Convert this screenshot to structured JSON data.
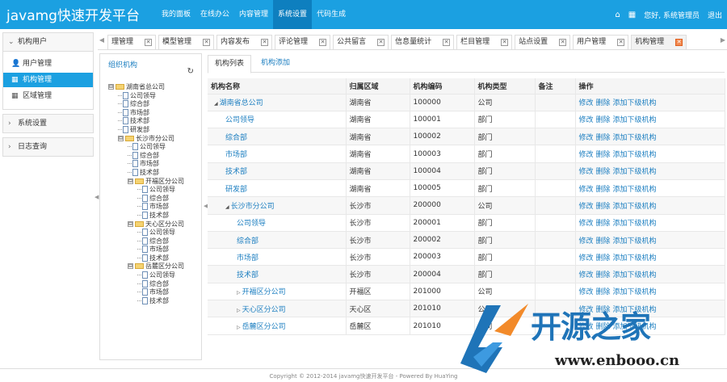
{
  "header": {
    "brand": "javamg快速开发平台",
    "nav": [
      {
        "label": "我的面板",
        "active": false
      },
      {
        "label": "在线办公",
        "active": false
      },
      {
        "label": "内容管理",
        "active": false
      },
      {
        "label": "系统设置",
        "active": true
      },
      {
        "label": "代码生成",
        "active": false
      }
    ],
    "user_text": "您好, 系统管理员",
    "logout": "退出"
  },
  "sidebar": {
    "groups": [
      {
        "label": "机构用户",
        "open": true,
        "items": [
          {
            "label": "用户管理",
            "icon": "user-icon",
            "glyph": "👤",
            "active": false
          },
          {
            "label": "机构管理",
            "icon": "grid-icon",
            "glyph": "▦",
            "active": true
          },
          {
            "label": "区域管理",
            "icon": "grid-small-icon",
            "glyph": "▦",
            "active": false
          }
        ]
      },
      {
        "label": "系统设置",
        "open": false,
        "items": []
      },
      {
        "label": "日志查询",
        "open": false,
        "items": []
      }
    ]
  },
  "tabs": [
    {
      "label": "理管理",
      "current": false
    },
    {
      "label": "模型管理",
      "current": false
    },
    {
      "label": "内容发布",
      "current": false
    },
    {
      "label": "评论管理",
      "current": false
    },
    {
      "label": "公共留言",
      "current": false
    },
    {
      "label": "信息量统计",
      "current": false
    },
    {
      "label": "栏目管理",
      "current": false
    },
    {
      "label": "站点设置",
      "current": false
    },
    {
      "label": "用户管理",
      "current": false
    },
    {
      "label": "机构管理",
      "current": true
    }
  ],
  "org_panel": {
    "title": "组织机构",
    "tree": [
      {
        "label": "湖南省总公司",
        "level": 0,
        "type": "folder",
        "toggle": "⊟"
      },
      {
        "label": "公司领导",
        "level": 1,
        "type": "doc"
      },
      {
        "label": "综合部",
        "level": 1,
        "type": "doc"
      },
      {
        "label": "市场部",
        "level": 1,
        "type": "doc"
      },
      {
        "label": "技术部",
        "level": 1,
        "type": "doc"
      },
      {
        "label": "研发部",
        "level": 1,
        "type": "doc"
      },
      {
        "label": "长沙市分公司",
        "level": 1,
        "type": "folder",
        "toggle": "⊟"
      },
      {
        "label": "公司领导",
        "level": 2,
        "type": "doc"
      },
      {
        "label": "综合部",
        "level": 2,
        "type": "doc"
      },
      {
        "label": "市场部",
        "level": 2,
        "type": "doc"
      },
      {
        "label": "技术部",
        "level": 2,
        "type": "doc"
      },
      {
        "label": "开福区分公司",
        "level": 2,
        "type": "folder",
        "toggle": "⊟"
      },
      {
        "label": "公司领导",
        "level": 3,
        "type": "doc"
      },
      {
        "label": "综合部",
        "level": 3,
        "type": "doc"
      },
      {
        "label": "市场部",
        "level": 3,
        "type": "doc"
      },
      {
        "label": "技术部",
        "level": 3,
        "type": "doc"
      },
      {
        "label": "天心区分公司",
        "level": 2,
        "type": "folder",
        "toggle": "⊟"
      },
      {
        "label": "公司领导",
        "level": 3,
        "type": "doc"
      },
      {
        "label": "综合部",
        "level": 3,
        "type": "doc"
      },
      {
        "label": "市场部",
        "level": 3,
        "type": "doc"
      },
      {
        "label": "技术部",
        "level": 3,
        "type": "doc"
      },
      {
        "label": "岳麓区分公司",
        "level": 2,
        "type": "folder",
        "toggle": "⊟"
      },
      {
        "label": "公司领导",
        "level": 3,
        "type": "doc"
      },
      {
        "label": "综合部",
        "level": 3,
        "type": "doc"
      },
      {
        "label": "市场部",
        "level": 3,
        "type": "doc"
      },
      {
        "label": "技术部",
        "level": 3,
        "type": "doc"
      }
    ]
  },
  "subtabs": {
    "list": "机构列表",
    "add": "机构添加"
  },
  "table": {
    "columns": [
      "机构名称",
      "归属区域",
      "机构编码",
      "机构类型",
      "备注",
      "操作"
    ],
    "ops": [
      "修改",
      "删除",
      "添加下级机构"
    ],
    "rows": [
      {
        "name": "湖南省总公司",
        "level": 0,
        "arrow": "◢",
        "region": "湖南省",
        "code": "100000",
        "type": "公司",
        "remark": ""
      },
      {
        "name": "公司领导",
        "level": 1,
        "arrow": "",
        "region": "湖南省",
        "code": "100001",
        "type": "部门",
        "remark": ""
      },
      {
        "name": "综合部",
        "level": 1,
        "arrow": "",
        "region": "湖南省",
        "code": "100002",
        "type": "部门",
        "remark": ""
      },
      {
        "name": "市场部",
        "level": 1,
        "arrow": "",
        "region": "湖南省",
        "code": "100003",
        "type": "部门",
        "remark": ""
      },
      {
        "name": "技术部",
        "level": 1,
        "arrow": "",
        "region": "湖南省",
        "code": "100004",
        "type": "部门",
        "remark": ""
      },
      {
        "name": "研发部",
        "level": 1,
        "arrow": "",
        "region": "湖南省",
        "code": "100005",
        "type": "部门",
        "remark": ""
      },
      {
        "name": "长沙市分公司",
        "level": 1,
        "arrow": "◢",
        "region": "长沙市",
        "code": "200000",
        "type": "公司",
        "remark": ""
      },
      {
        "name": "公司领导",
        "level": 2,
        "arrow": "",
        "region": "长沙市",
        "code": "200001",
        "type": "部门",
        "remark": ""
      },
      {
        "name": "综合部",
        "level": 2,
        "arrow": "",
        "region": "长沙市",
        "code": "200002",
        "type": "部门",
        "remark": ""
      },
      {
        "name": "市场部",
        "level": 2,
        "arrow": "",
        "region": "长沙市",
        "code": "200003",
        "type": "部门",
        "remark": ""
      },
      {
        "name": "技术部",
        "level": 2,
        "arrow": "",
        "region": "长沙市",
        "code": "200004",
        "type": "部门",
        "remark": ""
      },
      {
        "name": "开福区分公司",
        "level": 2,
        "arrow": "▷",
        "region": "开福区",
        "code": "201000",
        "type": "公司",
        "remark": ""
      },
      {
        "name": "天心区分公司",
        "level": 2,
        "arrow": "▷",
        "region": "天心区",
        "code": "201010",
        "type": "公司",
        "remark": ""
      },
      {
        "name": "岳麓区分公司",
        "level": 2,
        "arrow": "▷",
        "region": "岳麓区",
        "code": "201010",
        "type": "公司",
        "remark": ""
      }
    ]
  },
  "footer": "Copyright © 2012-2014 javamg快速开发平台 - Powered By HuaYing",
  "watermark": {
    "text": "开源之家",
    "url": "www.enbooo.cn"
  }
}
